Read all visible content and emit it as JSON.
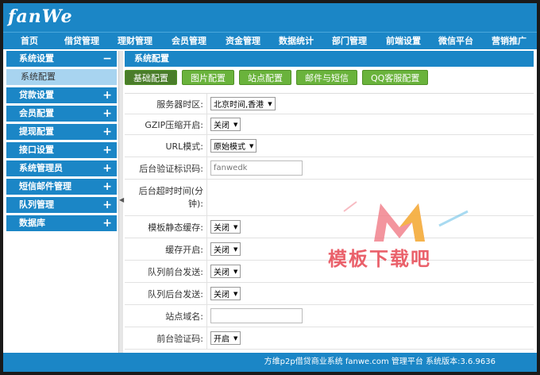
{
  "logo": "fanWe",
  "nav": {
    "items": [
      "首页",
      "借贷管理",
      "理财管理",
      "会员管理",
      "资金管理",
      "数据统计",
      "部门管理",
      "前端设置",
      "微信平台",
      "营销推广"
    ]
  },
  "sidebar": {
    "items": [
      {
        "label": "系统设置",
        "sign": "−",
        "type": "group"
      },
      {
        "label": "系统配置",
        "sign": "",
        "type": "sub"
      },
      {
        "label": "贷款设置",
        "sign": "+",
        "type": "group"
      },
      {
        "label": "会员配置",
        "sign": "+",
        "type": "group"
      },
      {
        "label": "提现配置",
        "sign": "+",
        "type": "group"
      },
      {
        "label": "接口设置",
        "sign": "+",
        "type": "group"
      },
      {
        "label": "系统管理员",
        "sign": "+",
        "type": "group"
      },
      {
        "label": "短信邮件管理",
        "sign": "+",
        "type": "group"
      },
      {
        "label": "队列管理",
        "sign": "+",
        "type": "group"
      },
      {
        "label": "数据库",
        "sign": "+",
        "type": "group"
      }
    ]
  },
  "main": {
    "title": "系统配置",
    "tabs": [
      "基础配置",
      "图片配置",
      "站点配置",
      "邮件与短信",
      "QQ客服配置"
    ]
  },
  "form": {
    "rows": [
      {
        "label": "服务器时区:",
        "kind": "select",
        "value": "北京时间,香港"
      },
      {
        "label": "GZIP压缩开启:",
        "kind": "select",
        "value": "关闭"
      },
      {
        "label": "URL模式:",
        "kind": "select",
        "value": "原始模式"
      },
      {
        "label": "后台验证标识码:",
        "kind": "input",
        "value": "fanwedk"
      },
      {
        "label": "后台超时时间(分钟):",
        "kind": "blank",
        "value": ""
      },
      {
        "label": "模板静态缓存:",
        "kind": "select",
        "value": "关闭"
      },
      {
        "label": "缓存开启:",
        "kind": "select",
        "value": "关闭"
      },
      {
        "label": "队列前台发送:",
        "kind": "select",
        "value": "关闭"
      },
      {
        "label": "队列后台发送:",
        "kind": "select",
        "value": "关闭"
      },
      {
        "label": "站点域名:",
        "kind": "input",
        "value": ""
      },
      {
        "label": "前台验证码:",
        "kind": "select",
        "value": "开启"
      }
    ]
  },
  "footer": {
    "text": "方维p2p借贷商业系统 fanwe.com 管理平台 系统版本:3.6.9636"
  },
  "watermark": {
    "text": "模板下载吧"
  }
}
